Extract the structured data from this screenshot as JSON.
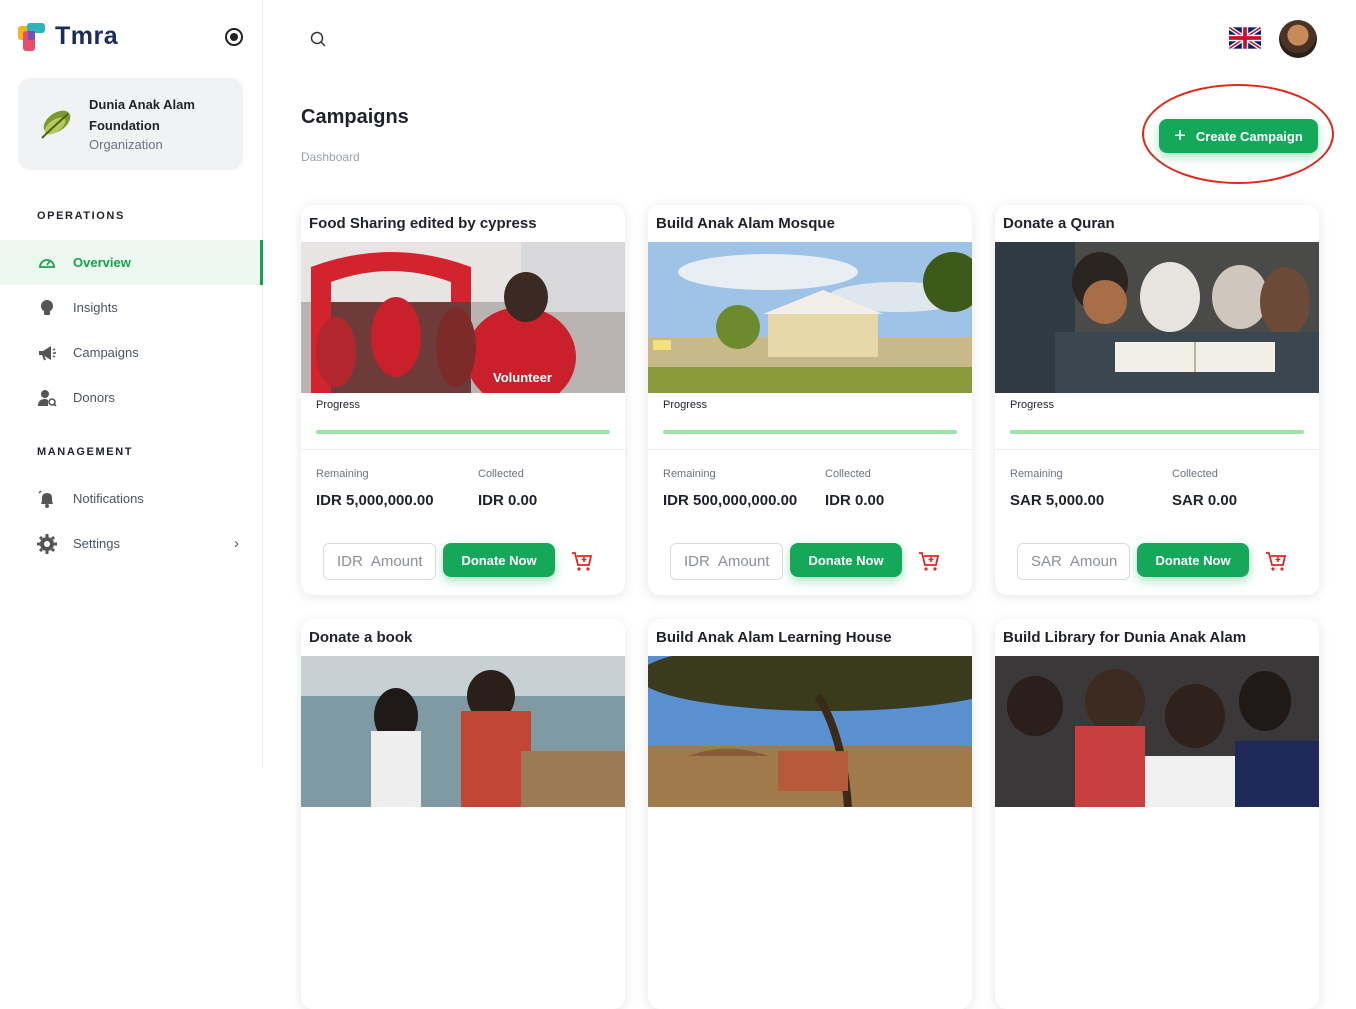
{
  "app": {
    "name": "Tmra"
  },
  "organization": {
    "name": "Dunia Anak Alam Foundation",
    "type": "Organization"
  },
  "sidebar": {
    "sections": [
      {
        "title": "OPERATIONS"
      },
      {
        "title": "MANAGEMENT"
      }
    ],
    "items": [
      {
        "label": "Overview",
        "icon": "dashboard-icon",
        "active": true
      },
      {
        "label": "Insights",
        "icon": "lightbulb-icon"
      },
      {
        "label": "Campaigns",
        "icon": "megaphone-icon"
      },
      {
        "label": "Donors",
        "icon": "user-search-icon"
      },
      {
        "label": "Notifications",
        "icon": "bell-icon"
      },
      {
        "label": "Settings",
        "icon": "gear-icon"
      }
    ]
  },
  "header": {
    "language_flag": "uk-flag-icon"
  },
  "page": {
    "title": "Campaigns",
    "breadcrumb": "Dashboard",
    "create_label": "Create Campaign"
  },
  "colors": {
    "accent": "#16a85a",
    "highlight": "#e0281a",
    "cart": "#e02424"
  },
  "cards": [
    {
      "title": "Food Sharing edited by cypress",
      "progress_label": "Progress",
      "progress": 1.0,
      "remaining_label": "Remaining",
      "remaining": "IDR 5,000,000.00",
      "collected_label": "Collected",
      "collected": "IDR 0.00",
      "currency": "IDR",
      "amount_placeholder": "Amount",
      "donate_label": "Donate Now"
    },
    {
      "title": "Build Anak Alam Mosque",
      "progress_label": "Progress",
      "progress": 1.0,
      "remaining_label": "Remaining",
      "remaining": "IDR 500,000,000.00",
      "collected_label": "Collected",
      "collected": "IDR 0.00",
      "currency": "IDR",
      "amount_placeholder": "Amount",
      "donate_label": "Donate Now"
    },
    {
      "title": "Donate a Quran",
      "progress_label": "Progress",
      "progress": 1.0,
      "remaining_label": "Remaining",
      "remaining": "SAR 5,000.00",
      "collected_label": "Collected",
      "collected": "SAR 0.00",
      "currency": "SAR",
      "amount_placeholder": "Amoun",
      "donate_label": "Donate Now"
    },
    {
      "title": "Donate a book"
    },
    {
      "title": "Build Anak Alam Learning House"
    },
    {
      "title": "Build Library for Dunia Anak Alam"
    }
  ]
}
